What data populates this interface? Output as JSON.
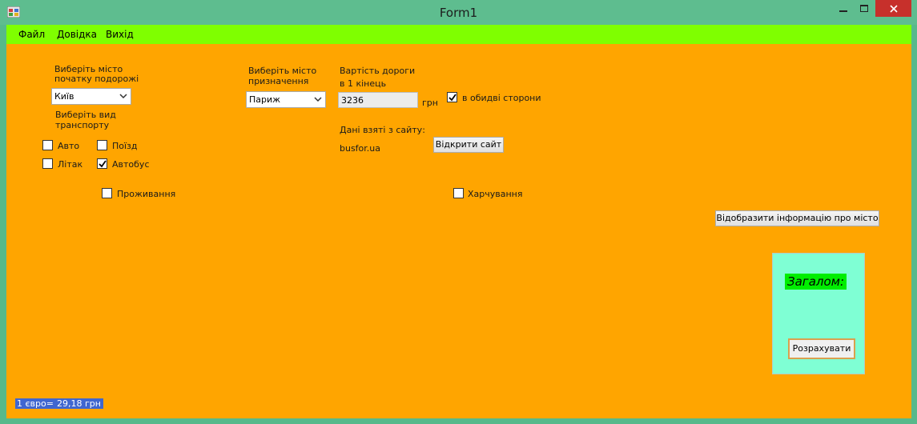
{
  "window": {
    "title": "Form1"
  },
  "menu": [
    "Файл",
    "Довідка",
    "Вихід"
  ],
  "origin": {
    "label_line1": "Виберіть місто",
    "label_line2": "початку подорожі",
    "selected": "Київ"
  },
  "transport": {
    "label_line1": "Виберіть вид",
    "label_line2": "транспорту",
    "options": [
      {
        "label": "Авто",
        "checked": false
      },
      {
        "label": "Поїзд",
        "checked": false
      },
      {
        "label": "Літак",
        "checked": false
      },
      {
        "label": "Автобус",
        "checked": true
      }
    ]
  },
  "destination": {
    "label_line1": "Виберіть місто",
    "label_line2": "призначення",
    "selected": "Париж"
  },
  "cost": {
    "label_line1": "Вартість дороги",
    "label_line2": "в 1 кінець",
    "value": "3236",
    "unit": "грн",
    "both_ways_label": "в обидві сторони",
    "both_ways_checked": true
  },
  "source": {
    "label": "Дані взяті з сайту:",
    "site": "busfor.ua",
    "open_button": "Відкрити сайт"
  },
  "extras": {
    "accommodation": {
      "label": "Проживання",
      "checked": false
    },
    "meals": {
      "label": "Харчування",
      "checked": false
    }
  },
  "city_info_button": "Відобразити інформацію про місто",
  "total": {
    "label": "Загалом:",
    "calc_button": "Розрахувати"
  },
  "rate": {
    "label": "1 євро=",
    "value": "29,18  грн"
  }
}
